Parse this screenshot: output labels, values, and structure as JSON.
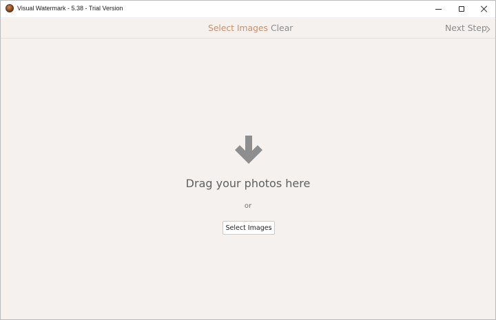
{
  "window": {
    "title": "Visual Watermark - 5.38 - Trial Version",
    "app_icon": "visual-watermark-logo"
  },
  "toolbar": {
    "select_images": "Select Images",
    "clear": "Clear",
    "next_step": "Next Step"
  },
  "dropzone": {
    "icon": "arrow-down-icon",
    "headline": "Drag your photos here",
    "or": "or",
    "button_label": "Select Images"
  },
  "colors": {
    "accent": "#c9906a",
    "muted": "#8c8c8c",
    "background": "#f4f1ef",
    "icon": "#8e8e8e"
  }
}
